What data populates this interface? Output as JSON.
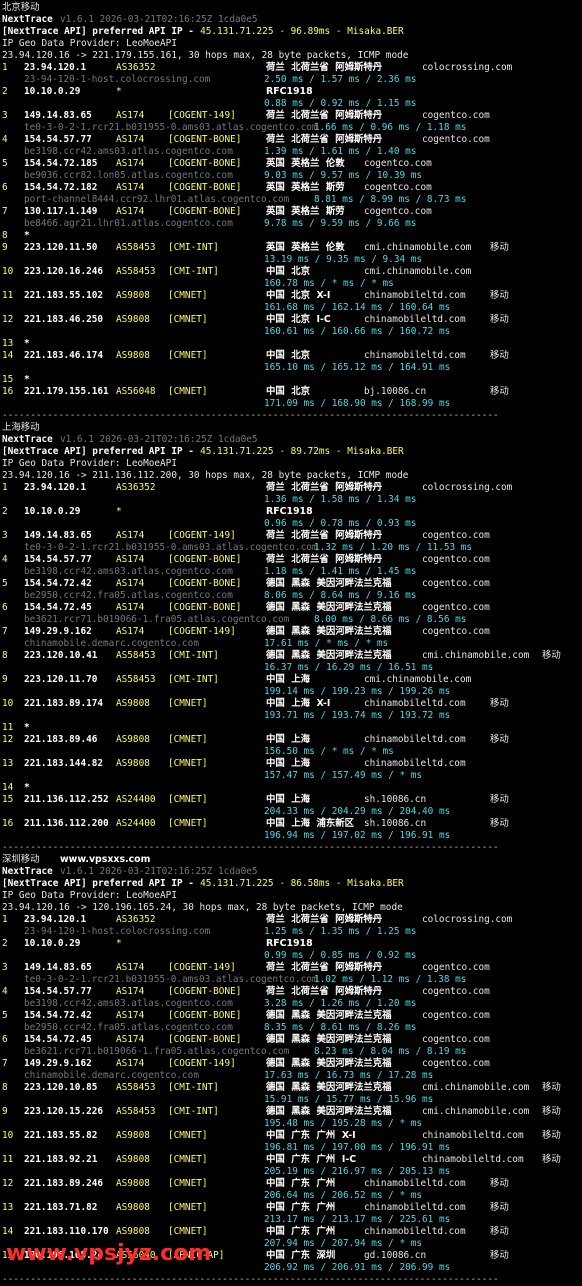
{
  "watermark": {
    "site": "www.vpsjyz.com",
    "site_top": "www.vpsxxs.com"
  },
  "sections": [
    {
      "label": "北京移动",
      "app": "NextTrace",
      "version": "v1.6.1 2026-03-21T02:16:25Z 1cda0e5",
      "api_prefix": "[NextTrace API] preferred API IP - ",
      "api_ip": "45.131.71.225",
      "api_rtt": "96.89ms",
      "api_node": "Misaka.BER",
      "geo": "IP Geo Data Provider: LeoMoeAPI",
      "trace": "23.94.120.16 -> 221.179.155.161, 30 hops max, 28 byte packets, ICMP mode",
      "hops": [
        {
          "n": "1",
          "ip": "23.94.120.1",
          "as": "AS36352",
          "tag": "",
          "geo": "荷兰  北荷兰省  阿姆斯特丹",
          "dom": "colocrossing.com",
          "extra": "",
          "host": "23-94-120-1-host.colocrossing.com",
          "rtt": "2.50 ms / 1.57 ms / 2.36 ms"
        },
        {
          "n": "2",
          "ip": "10.10.0.29",
          "as": "*",
          "tag": "",
          "geo": "RFC1918",
          "dom": "",
          "extra": "",
          "host": "",
          "rtt": "0.88 ms / 0.92 ms / 1.15 ms"
        },
        {
          "n": "3",
          "ip": "149.14.83.65",
          "as": "AS174",
          "tag": "[COGENT-149]",
          "geo": "荷兰  北荷兰省  阿姆斯特丹",
          "dom": "cogentco.com",
          "extra": "",
          "host": "te0-3-0-2-1.rcr21.b031955-0.ams03.atlas.cogentco.com",
          "rtt": "1.66 ms / 0.96 ms / 1.18 ms"
        },
        {
          "n": "4",
          "ip": "154.54.57.77",
          "as": "AS174",
          "tag": "[COGENT-BONE]",
          "geo": "荷兰  北荷兰省  阿姆斯特丹",
          "dom": "cogentco.com",
          "extra": "",
          "host": "be3198.ccr42.ams03.atlas.cogentco.com",
          "rtt": "1.39 ms / 1.61 ms / 1.40 ms"
        },
        {
          "n": "5",
          "ip": "154.54.72.185",
          "as": "AS174",
          "tag": "[COGENT-BONE]",
          "geo": "英国  英格兰  伦敦",
          "dom": "cogentco.com",
          "extra": "",
          "host": "be9036.ccr82.lon05.atlas.cogentco.com",
          "rtt": "9.03 ms / 9.57 ms / 10.39 ms"
        },
        {
          "n": "6",
          "ip": "154.54.72.182",
          "as": "AS174",
          "tag": "[COGENT-BONE]",
          "geo": "英国  英格兰  斯劳",
          "dom": "cogentco.com",
          "extra": "",
          "host": "port-channel8444.ccr92.lhr01.atlas.cogentco.com",
          "rtt": "8.81 ms / 8.99 ms / 8.73 ms"
        },
        {
          "n": "7",
          "ip": "130.117.1.149",
          "as": "AS174",
          "tag": "[COGENT-BONE]",
          "geo": "英国  英格兰  斯劳",
          "dom": "cogentco.com",
          "extra": "",
          "host": "be8466.agr21.lhr01.atlas.cogentco.com",
          "rtt": "9.78 ms / 9.59 ms / 9.66 ms"
        },
        {
          "n": "8",
          "ip": "*",
          "as": "",
          "tag": "",
          "geo": "",
          "dom": "",
          "extra": "",
          "host": "",
          "rtt": ""
        },
        {
          "n": "9",
          "ip": "223.120.11.50",
          "as": "AS58453",
          "tag": "[CMI-INT]",
          "geo": "英国  英格兰  伦敦",
          "dom": "cmi.chinamobile.com",
          "extra": "移动",
          "host": "",
          "rtt": "13.19 ms / 9.35 ms / 9.34 ms"
        },
        {
          "n": "10",
          "ip": "223.120.16.246",
          "as": "AS58453",
          "tag": "[CMI-INT]",
          "geo": "中国  北京",
          "dom": "cmi.chinamobile.com",
          "extra": "",
          "host": "",
          "rtt": "160.78 ms / * ms / * ms"
        },
        {
          "n": "11",
          "ip": "221.183.55.102",
          "as": "AS9808",
          "tag": "[CMNET]",
          "geo": "中国  北京  X-I",
          "dom": "chinamobileltd.com",
          "extra": "移动",
          "host": "",
          "rtt": "161.68 ms / 162.14 ms / 160.64 ms"
        },
        {
          "n": "12",
          "ip": "221.183.46.250",
          "as": "AS9808",
          "tag": "[CMNET]",
          "geo": "中国  北京  I-C",
          "dom": "chinamobileltd.com",
          "extra": "移动",
          "host": "",
          "rtt": "160.61 ms / 160.66 ms / 160.72 ms"
        },
        {
          "n": "13",
          "ip": "*",
          "as": "",
          "tag": "",
          "geo": "",
          "dom": "",
          "extra": "",
          "host": "",
          "rtt": ""
        },
        {
          "n": "14",
          "ip": "221.183.46.174",
          "as": "AS9808",
          "tag": "[CMNET]",
          "geo": "中国  北京",
          "dom": "chinamobileltd.com",
          "extra": "移动",
          "host": "",
          "rtt": "165.10 ms / 165.12 ms / 164.91 ms"
        },
        {
          "n": "15",
          "ip": "*",
          "as": "",
          "tag": "",
          "geo": "",
          "dom": "",
          "extra": "",
          "host": "",
          "rtt": ""
        },
        {
          "n": "16",
          "ip": "221.179.155.161",
          "as": "AS56048",
          "tag": "[CMNET]",
          "geo": "中国  北京",
          "dom": "bj.10086.cn",
          "extra": "移动",
          "host": "",
          "rtt": "171.09 ms / 168.90 ms / 168.99 ms"
        }
      ]
    },
    {
      "label": "上海移动",
      "app": "NextTrace",
      "version": "v1.6.1 2026-03-21T02:16:25Z 1cda0e5",
      "api_prefix": "[NextTrace API] preferred API IP - ",
      "api_ip": "45.131.71.225",
      "api_rtt": "89.72ms",
      "api_node": "Misaka.BER",
      "geo": "IP Geo Data Provider: LeoMoeAPI",
      "trace": "23.94.120.16 -> 211.136.112.200, 30 hops max, 28 byte packets, ICMP mode",
      "hops": [
        {
          "n": "1",
          "ip": "23.94.120.1",
          "as": "AS36352",
          "tag": "",
          "geo": "荷兰  北荷兰省  阿姆斯特丹",
          "dom": "colocrossing.com",
          "extra": "",
          "host": "",
          "rtt": "1.36 ms / 1.58 ms / 1.34 ms"
        },
        {
          "n": "2",
          "ip": "10.10.0.29",
          "as": "*",
          "tag": "",
          "geo": "RFC1918",
          "dom": "",
          "extra": "",
          "host": "",
          "rtt": "0.96 ms / 0.78 ms / 0.93 ms"
        },
        {
          "n": "3",
          "ip": "149.14.83.65",
          "as": "AS174",
          "tag": "[COGENT-149]",
          "geo": "荷兰  北荷兰省  阿姆斯特丹",
          "dom": "cogentco.com",
          "extra": "",
          "host": "te0-3-0-2-1.rcr21.b031955-0.ams03.atlas.cogentco.com",
          "rtt": "1.32 ms / 1.20 ms / 11.53 ms"
        },
        {
          "n": "4",
          "ip": "154.54.57.77",
          "as": "AS174",
          "tag": "[COGENT-BONE]",
          "geo": "荷兰  北荷兰省  阿姆斯特丹",
          "dom": "cogentco.com",
          "extra": "",
          "host": "be3198.ccr42.ams03.atlas.cogentco.com",
          "rtt": "1.18 ms / 1.41 ms / 1.45 ms"
        },
        {
          "n": "5",
          "ip": "154.54.72.42",
          "as": "AS174",
          "tag": "[COGENT-BONE]",
          "geo": "德国  黑森  美因河畔法兰克福",
          "dom": "cogentco.com",
          "extra": "",
          "host": "be2950.ccr42.fra05.atlas.cogentco.com",
          "rtt": "8.06 ms / 8.64 ms / 9.16 ms"
        },
        {
          "n": "6",
          "ip": "154.54.72.45",
          "as": "AS174",
          "tag": "[COGENT-BONE]",
          "geo": "德国  黑森  美因河畔法兰克福",
          "dom": "cogentco.com",
          "extra": "",
          "host": "be3621.rcr71.b019066-1.fra05.atlas.cogentco.com",
          "rtt": "8.00 ms / 8.66 ms / 8.56 ms"
        },
        {
          "n": "7",
          "ip": "149.29.9.162",
          "as": "AS174",
          "tag": "[COGENT-149]",
          "geo": "德国  黑森  美因河畔法兰克福",
          "dom": "cogentco.com",
          "extra": "",
          "host": "chinamobile.demarc.cogentco.com",
          "rtt": "17.61 ms / * ms / * ms"
        },
        {
          "n": "8",
          "ip": "223.120.10.41",
          "as": "AS58453",
          "tag": "[CMI-INT]",
          "geo": "德国  黑森  美因河畔法兰克福",
          "dom": "cmi.chinamobile.com",
          "extra": "移动",
          "host": "",
          "rtt": "16.37 ms / 16.29 ms / 16.51 ms"
        },
        {
          "n": "9",
          "ip": "223.120.11.70",
          "as": "AS58453",
          "tag": "[CMI-INT]",
          "geo": "中国  上海",
          "dom": "cmi.chinamobile.com",
          "extra": "",
          "host": "",
          "rtt": "199.14 ms / 199.23 ms / 199.26 ms"
        },
        {
          "n": "10",
          "ip": "221.183.89.174",
          "as": "AS9808",
          "tag": "[CMNET]",
          "geo": "中国  上海  X-I",
          "dom": "chinamobileltd.com",
          "extra": "移动",
          "host": "",
          "rtt": "193.71 ms / 193.74 ms / 193.72 ms"
        },
        {
          "n": "11",
          "ip": "*",
          "as": "",
          "tag": "",
          "geo": "",
          "dom": "",
          "extra": "",
          "host": "",
          "rtt": ""
        },
        {
          "n": "12",
          "ip": "221.183.89.46",
          "as": "AS9808",
          "tag": "[CMNET]",
          "geo": "中国  上海",
          "dom": "chinamobileltd.com",
          "extra": "移动",
          "host": "",
          "rtt": "156.50 ms / * ms / * ms"
        },
        {
          "n": "13",
          "ip": "221.183.144.82",
          "as": "AS9808",
          "tag": "[CMNET]",
          "geo": "中国  上海",
          "dom": "chinamobileltd.com",
          "extra": "",
          "host": "",
          "rtt": "157.47 ms / 157.49 ms / * ms"
        },
        {
          "n": "14",
          "ip": "*",
          "as": "",
          "tag": "",
          "geo": "",
          "dom": "",
          "extra": "",
          "host": "",
          "rtt": ""
        },
        {
          "n": "15",
          "ip": "211.136.112.252",
          "as": "AS24400",
          "tag": "[CMNET]",
          "geo": "中国  上海",
          "dom": "sh.10086.cn",
          "extra": "移动",
          "host": "",
          "rtt": "204.33 ms / 204.29 ms / 204.40 ms"
        },
        {
          "n": "16",
          "ip": "211.136.112.200",
          "as": "AS24400",
          "tag": "[CMNET]",
          "geo": "中国  上海  浦东新区",
          "dom": "sh.10086.cn",
          "extra": "移动",
          "host": "",
          "rtt": "196.94 ms / 197.02 ms / 196.91 ms"
        }
      ]
    },
    {
      "label": "深圳移动",
      "app": "NextTrace",
      "version": "v1.6.1 2026-03-21T02:16:25Z 1cda0e5",
      "api_prefix": "[NextTrace API] preferred API IP - ",
      "api_ip": "45.131.71.225",
      "api_rtt": "86.58ms",
      "api_node": "Misaka.BER",
      "geo": "IP Geo Data Provider: LeoMoeAPI",
      "trace": "23.94.120.16 -> 120.196.165.24, 30 hops max, 28 byte packets, ICMP mode",
      "hops": [
        {
          "n": "1",
          "ip": "23.94.120.1",
          "as": "AS36352",
          "tag": "",
          "geo": "荷兰  北荷兰省  阿姆斯特丹",
          "dom": "colocrossing.com",
          "extra": "",
          "host": "23-94-120-1-host.colocrossing.com",
          "rtt": "1.25 ms / 1.35 ms / 1.25 ms"
        },
        {
          "n": "2",
          "ip": "10.10.0.29",
          "as": "*",
          "tag": "",
          "geo": "RFC1918",
          "dom": "",
          "extra": "",
          "host": "",
          "rtt": "0.99 ms / 0.85 ms / 0.92 ms"
        },
        {
          "n": "3",
          "ip": "149.14.83.65",
          "as": "AS174",
          "tag": "[COGENT-149]",
          "geo": "荷兰  北荷兰省  阿姆斯特丹",
          "dom": "cogentco.com",
          "extra": "",
          "host": "te0-3-0-2-1.rcr21.b031955-0.ams03.atlas.cogentco.com",
          "rtt": "1.02 ms / 1.12 ms / 1.38 ms"
        },
        {
          "n": "4",
          "ip": "154.54.57.77",
          "as": "AS174",
          "tag": "[COGENT-BONE]",
          "geo": "荷兰  北荷兰省  阿姆斯特丹",
          "dom": "cogentco.com",
          "extra": "",
          "host": "be3198.ccr42.ams03.atlas.cogentco.com",
          "rtt": "3.28 ms / 1.26 ms / 1.20 ms"
        },
        {
          "n": "5",
          "ip": "154.54.72.42",
          "as": "AS174",
          "tag": "[COGENT-BONE]",
          "geo": "德国  黑森  美因河畔法兰克福",
          "dom": "cogentco.com",
          "extra": "",
          "host": "be2950.ccr42.fra05.atlas.cogentco.com",
          "rtt": "8.35 ms / 8.61 ms / 8.26 ms"
        },
        {
          "n": "6",
          "ip": "154.54.72.45",
          "as": "AS174",
          "tag": "[COGENT-BONE]",
          "geo": "德国  黑森  美因河畔法兰克福",
          "dom": "cogentco.com",
          "extra": "",
          "host": "be3621.rcr71.b019066-1.fra05.atlas.cogentco.com",
          "rtt": "8.23 ms / 8.04 ms / 8.19 ms"
        },
        {
          "n": "7",
          "ip": "149.29.9.162",
          "as": "AS174",
          "tag": "[COGENT-149]",
          "geo": "德国  黑森  美因河畔法兰克福",
          "dom": "cogentco.com",
          "extra": "",
          "host": "chinamobile.demarc.cogentco.com",
          "rtt": "17.63 ms / 16.73 ms / 17.28 ms"
        },
        {
          "n": "8",
          "ip": "223.120.10.85",
          "as": "AS58453",
          "tag": "[CMI-INT]",
          "geo": "德国  黑森  美因河畔法兰克福",
          "dom": "cmi.chinamobile.com",
          "extra": "移动",
          "host": "",
          "rtt": "15.91 ms / 15.77 ms / 15.96 ms"
        },
        {
          "n": "9",
          "ip": "223.120.15.226",
          "as": "AS58453",
          "tag": "[CMI-INT]",
          "geo": "德国  黑森  美因河畔法兰克福",
          "dom": "cmi.chinamobile.com",
          "extra": "移动",
          "host": "",
          "rtt": "195.48 ms / 195.28 ms / * ms"
        },
        {
          "n": "10",
          "ip": "221.183.55.82",
          "as": "AS9808",
          "tag": "[CMNET]",
          "geo": "中国  广东  广州  X-I",
          "dom": "chinamobileltd.com",
          "extra": "移动",
          "host": "",
          "rtt": "196.81 ms / 197.00 ms / 196.91 ms"
        },
        {
          "n": "11",
          "ip": "221.183.92.21",
          "as": "AS9808",
          "tag": "[CMNET]",
          "geo": "中国  广东  广州  I-C",
          "dom": "chinamobileltd.com",
          "extra": "移动",
          "host": "",
          "rtt": "205.19 ms / 216.97 ms / 205.13 ms"
        },
        {
          "n": "12",
          "ip": "221.183.89.246",
          "as": "AS9808",
          "tag": "[CMNET]",
          "geo": "中国  广东  广州",
          "dom": "chinamobileltd.com",
          "extra": "移动",
          "host": "",
          "rtt": "206.64 ms / 206.52 ms / * ms"
        },
        {
          "n": "13",
          "ip": "221.183.71.82",
          "as": "AS9808",
          "tag": "[CMNET]",
          "geo": "中国  广东  广州",
          "dom": "chinamobileltd.com",
          "extra": "移动",
          "host": "",
          "rtt": "213.17 ms / 213.17 ms / 225.61 ms"
        },
        {
          "n": "14",
          "ip": "221.183.110.170",
          "as": "AS9808",
          "tag": "[CMNET]",
          "geo": "中国  广东  广州",
          "dom": "chinamobileltd.com",
          "extra": "移动",
          "host": "",
          "rtt": "207.94 ms / 207.94 ms / * ms"
        },
        {
          "n": "15",
          "ip": "120.196.165.24",
          "as": "AS56040",
          "tag": "[APNIC-AP]",
          "geo": "中国  广东  深圳",
          "dom": "gd.10086.cn",
          "extra": "移动",
          "host": "",
          "rtt": "206.92 ms / 206.91 ms / 206.99 ms"
        }
      ]
    }
  ],
  "separator": "----------------------------------------------------------------------------------------",
  "colors": {
    "background": "#000000",
    "hop_number": "#ffff55",
    "ip": "#ffffff",
    "asn": "#ffff55",
    "tag": "#ffff55",
    "rtt": "#4fd8e6",
    "hostname": "#777777",
    "watermark": "#ff2a2a"
  }
}
